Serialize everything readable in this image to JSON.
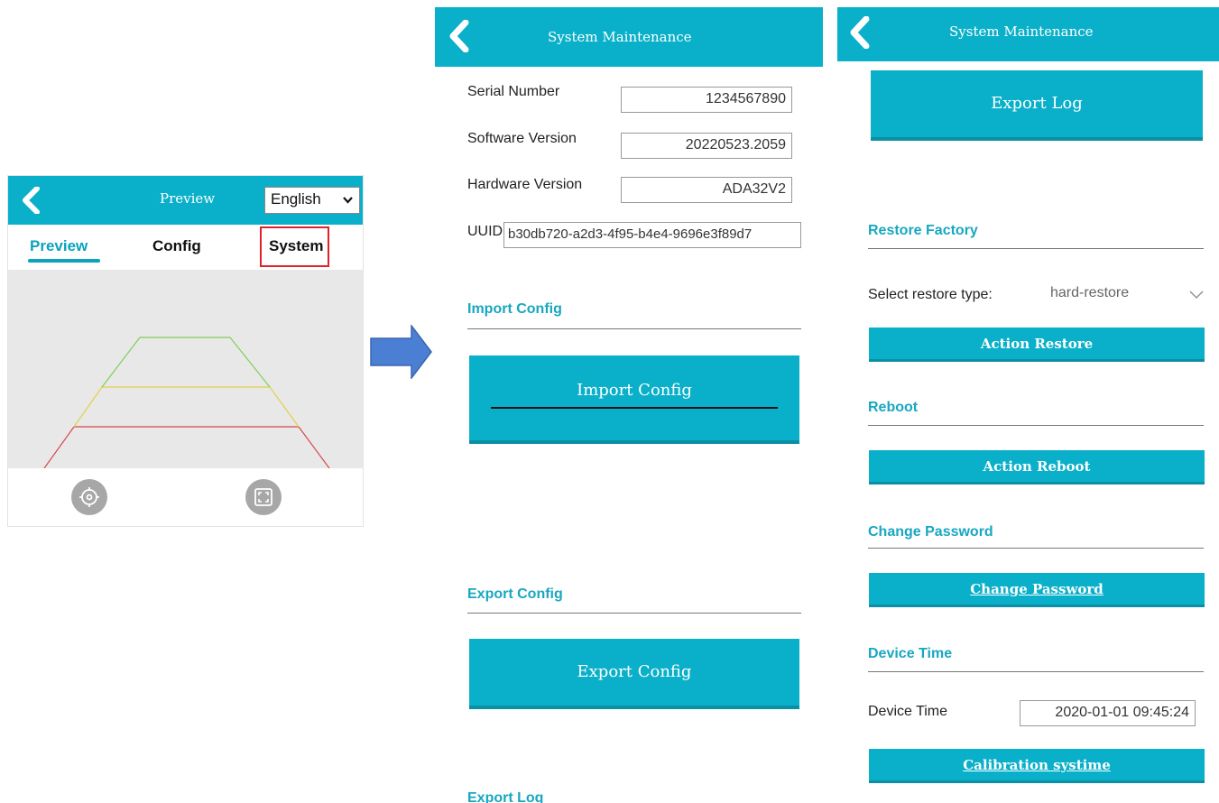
{
  "colors": {
    "accent": "#0ab0c9",
    "section": "#18a7c1",
    "highlight": "#e3212a",
    "arrow": "#4a7fd4"
  },
  "preview_screen": {
    "title": "Preview",
    "language": "English",
    "tabs": [
      {
        "label": "Preview",
        "active": true
      },
      {
        "label": "Config",
        "active": false
      },
      {
        "label": "System",
        "active": false,
        "highlighted": true
      }
    ],
    "icons": [
      "back-chevron-icon",
      "target-icon",
      "fullscreen-icon"
    ]
  },
  "maintenance_screen_1": {
    "title": "System Maintenance",
    "info": [
      {
        "label": "Serial Number",
        "value": "1234567890"
      },
      {
        "label": "Software Version",
        "value": "20220523.2059"
      },
      {
        "label": "Hardware Version",
        "value": "ADA32V2"
      },
      {
        "label": "UUID",
        "value": "b30db720-a2d3-4f95-b4e4-9696e3f89d7"
      }
    ],
    "import_section_title": "Import Config",
    "import_button": "Import Config",
    "export_section_title": "Export Config",
    "export_button": "Export Config",
    "export_log_title": "Export Log"
  },
  "maintenance_screen_2": {
    "title": "System Maintenance",
    "export_log_button": "Export Log",
    "restore_section_title": "Restore Factory",
    "restore_label": "Select restore type:",
    "restore_value": "hard-restore",
    "restore_button": "Action Restore",
    "reboot_section_title": "Reboot",
    "reboot_button": "Action Reboot",
    "password_section_title": "Change Password",
    "password_button": "Change Password",
    "time_section_title": "Device Time",
    "time_label": "Device Time",
    "time_value": "2020-01-01 09:45:24",
    "calibrate_button": "Calibration systime"
  }
}
